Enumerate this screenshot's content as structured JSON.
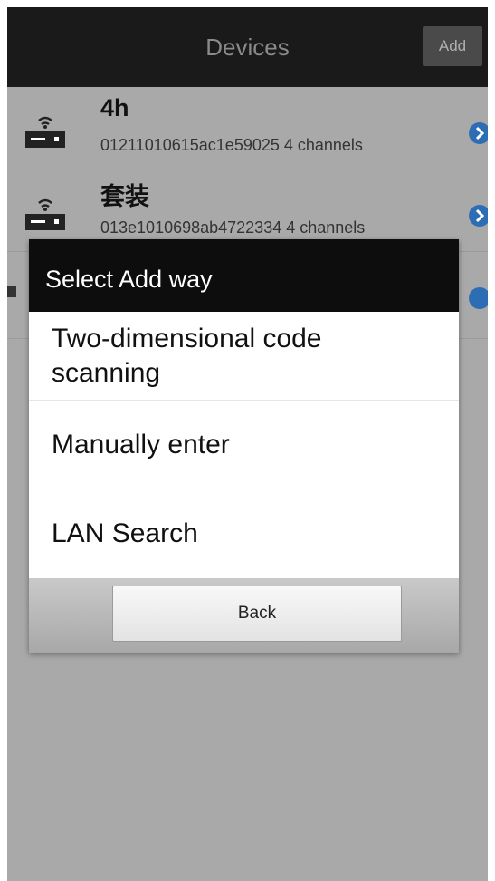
{
  "header": {
    "title": "Devices",
    "add_label": "Add"
  },
  "devices": [
    {
      "name": "4h",
      "info": "01211010615ac1e59025 4 channels",
      "icon": "router-wifi-icon"
    },
    {
      "name": "套装",
      "info": "013e1010698ab4722334 4 channels",
      "icon": "router-wifi-icon"
    }
  ],
  "dialog": {
    "title": "Select Add way",
    "options": [
      "Two-dimensional code scanning",
      "Manually enter",
      "LAN Search"
    ],
    "back_label": "Back"
  },
  "colors": {
    "header_bg": "#1a1a1a",
    "dimmed_bg": "#a9a9a9",
    "arrow_accent": "#2d6db4"
  }
}
